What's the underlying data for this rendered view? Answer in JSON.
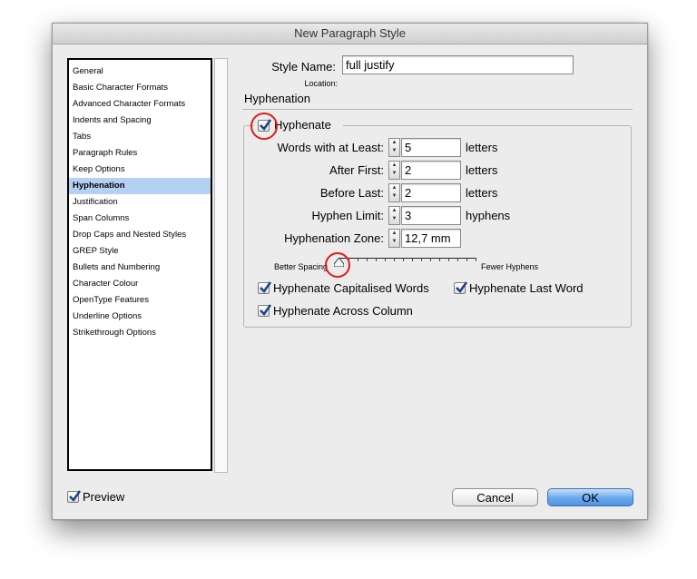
{
  "window": {
    "title": "New Paragraph Style"
  },
  "sidebar": {
    "items": [
      {
        "label": "General"
      },
      {
        "label": "Basic Character Formats"
      },
      {
        "label": "Advanced Character Formats"
      },
      {
        "label": "Indents and Spacing"
      },
      {
        "label": "Tabs"
      },
      {
        "label": "Paragraph Rules"
      },
      {
        "label": "Keep Options"
      },
      {
        "label": "Hyphenation",
        "selected": true
      },
      {
        "label": "Justification"
      },
      {
        "label": "Span Columns"
      },
      {
        "label": "Drop Caps and Nested Styles"
      },
      {
        "label": "GREP Style"
      },
      {
        "label": "Bullets and Numbering"
      },
      {
        "label": "Character Colour"
      },
      {
        "label": "OpenType Features"
      },
      {
        "label": "Underline Options"
      },
      {
        "label": "Strikethrough Options"
      }
    ]
  },
  "style": {
    "name_label": "Style Name:",
    "name_value": "full justify",
    "location_label": "Location:"
  },
  "section_title": "Hyphenation",
  "hyphenate": {
    "label": "Hyphenate",
    "checked": true
  },
  "fields": {
    "words_min": {
      "label": "Words with at Least:",
      "value": "5",
      "unit": "letters"
    },
    "after_first": {
      "label": "After First:",
      "value": "2",
      "unit": "letters"
    },
    "before_last": {
      "label": "Before Last:",
      "value": "2",
      "unit": "letters"
    },
    "hyphen_limit": {
      "label": "Hyphen Limit:",
      "value": "3",
      "unit": "hyphens"
    },
    "hyphenation_zone": {
      "label": "Hyphenation Zone:",
      "value": "12,7 mm"
    }
  },
  "slider": {
    "left_label": "Better Spacing",
    "right_label": "Fewer Hyphens",
    "value": 0
  },
  "options": {
    "capitalised": {
      "label": "Hyphenate Capitalised Words",
      "checked": true
    },
    "last_word": {
      "label": "Hyphenate Last Word",
      "checked": true
    },
    "across_column": {
      "label": "Hyphenate Across Column",
      "checked": true
    }
  },
  "preview": {
    "label": "Preview",
    "checked": true
  },
  "buttons": {
    "cancel": "Cancel",
    "ok": "OK"
  },
  "colors": {
    "accent": "#4f95e6",
    "selection": "#b4d0f3",
    "annotation": "#e21a1a"
  }
}
